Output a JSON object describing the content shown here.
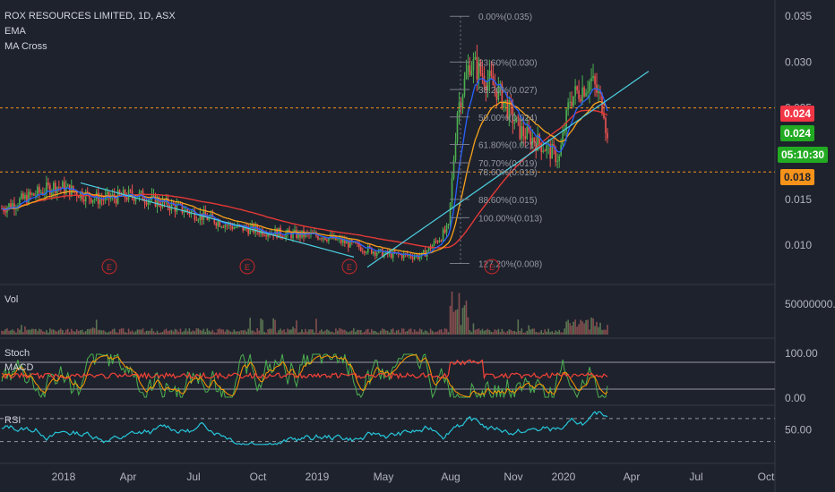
{
  "header": {
    "title": "ROX RESOURCES LIMITED, 1D, ASX",
    "indicators": [
      "EMA",
      "MA Cross"
    ]
  },
  "colors": {
    "background": "#1e222d",
    "up": "#26a69a",
    "up_candle": "#4caf50",
    "down_candle": "#ef5350",
    "ema_blue": "#2962ff",
    "ema_orange": "#f7a21b",
    "ma_red": "#e53935",
    "trend_cyan": "#4dd0e1",
    "fib_text": "#9598a1",
    "rsi": "#26c6da",
    "stoch_green": "#4caf50",
    "stoch_orange": "#ff9800",
    "macd_blue": "#2196f3",
    "macd_red": "#f44336",
    "earnings_red": "#c62828"
  },
  "chart_data": [
    {
      "type": "candlestick",
      "name": "price",
      "y_axis_ticks": [
        "0.035",
        "0.030",
        "0.025",
        "0.020",
        "0.015",
        "0.010"
      ],
      "ylim": [
        0.006,
        0.036
      ],
      "x_axis_ticks": [
        "2018",
        "Apr",
        "Jul",
        "Oct",
        "2019",
        "May",
        "Aug",
        "Nov",
        "2020",
        "Apr",
        "Jul",
        "Oct"
      ],
      "price_labels": [
        {
          "value": "0.024",
          "color": "#f23645"
        },
        {
          "value": "0.024",
          "color": "#22ab22"
        },
        {
          "value": "05:10:30",
          "color": "#22ab22"
        },
        {
          "value": "0.018",
          "color": "#f7931a"
        }
      ],
      "horizontal_levels": [
        0.025,
        0.018
      ],
      "fib_levels": [
        {
          "label": "0.00%(0.035)",
          "value": 0.035
        },
        {
          "label": "23.60%(0.030)",
          "value": 0.03
        },
        {
          "label": "38.20%(0.027)",
          "value": 0.027
        },
        {
          "label": "50.00%(0.024)",
          "value": 0.024
        },
        {
          "label": "61.80%(0.021)",
          "value": 0.021
        },
        {
          "label": "70.70%(0.019)",
          "value": 0.019
        },
        {
          "label": "78.60%(0.018)",
          "value": 0.018
        },
        {
          "label": "88.60%(0.015)",
          "value": 0.015
        },
        {
          "label": "100.00%(0.013)",
          "value": 0.013
        },
        {
          "label": "127.20%(0.008)",
          "value": 0.008
        }
      ],
      "earnings_markers": [
        "E",
        "E",
        "E",
        "E"
      ]
    },
    {
      "type": "bar",
      "name": "Vol",
      "y_axis_ticks": [
        "50000000.0"
      ]
    },
    {
      "type": "line",
      "name": "Stoch / MACD",
      "labels": [
        "Stoch",
        "MACD"
      ],
      "y_axis_ticks": [
        "100.00",
        "0.00"
      ]
    },
    {
      "type": "line",
      "name": "RSI",
      "y_axis_ticks": [
        "50.00"
      ]
    }
  ]
}
